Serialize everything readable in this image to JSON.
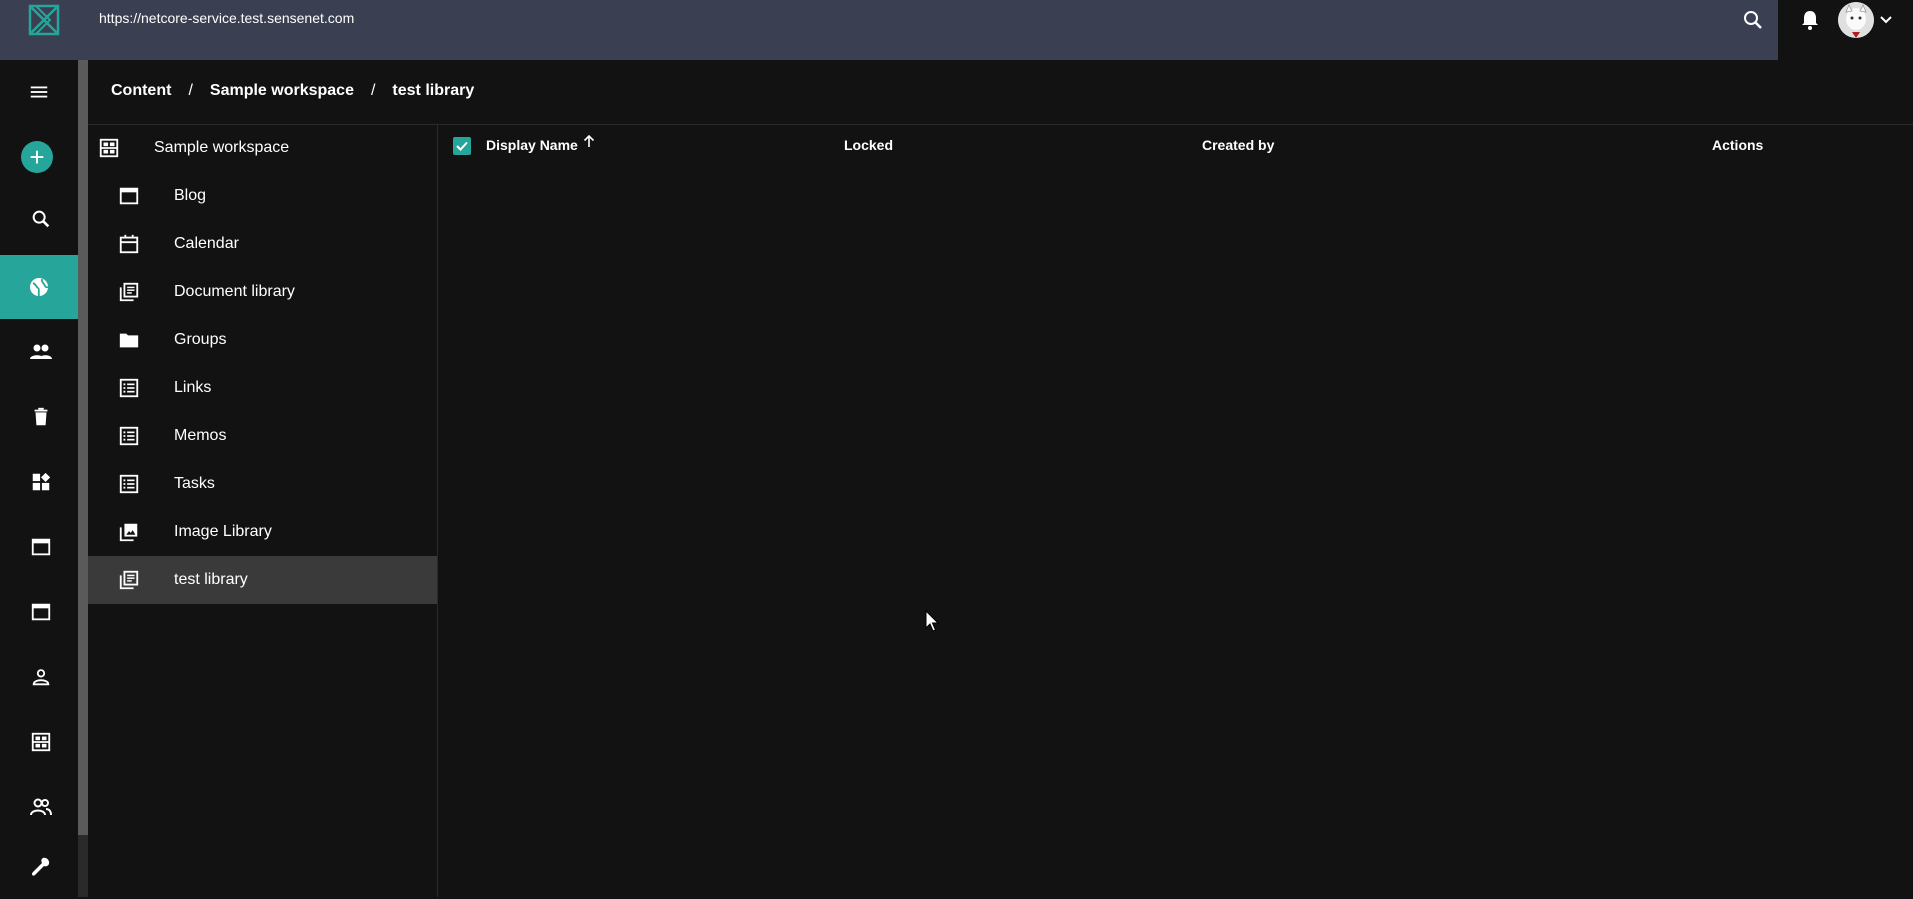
{
  "header": {
    "url": "https://netcore-service.test.sensenet.com"
  },
  "breadcrumb": {
    "items": [
      "Content",
      "Sample workspace",
      "test library"
    ],
    "separator": "/"
  },
  "tree": {
    "root": {
      "label": "Sample workspace",
      "icon": "workspace-icon"
    },
    "items": [
      {
        "label": "Blog",
        "icon": "window-icon",
        "selected": false
      },
      {
        "label": "Calendar",
        "icon": "calendar-icon",
        "selected": false
      },
      {
        "label": "Document library",
        "icon": "library-icon",
        "selected": false
      },
      {
        "label": "Groups",
        "icon": "folder-icon",
        "selected": false
      },
      {
        "label": "Links",
        "icon": "list-icon",
        "selected": false
      },
      {
        "label": "Memos",
        "icon": "list-icon",
        "selected": false
      },
      {
        "label": "Tasks",
        "icon": "list-icon",
        "selected": false
      },
      {
        "label": "Image Library",
        "icon": "image-library-icon",
        "selected": false
      },
      {
        "label": "test library",
        "icon": "library-icon",
        "selected": true
      }
    ]
  },
  "grid": {
    "columns": [
      "Display Name",
      "Locked",
      "Created by",
      "Actions"
    ],
    "sort": {
      "column": "Display Name",
      "direction": "ascending"
    },
    "select_all_checked": true
  },
  "leftnav": {
    "items": [
      "menu-icon",
      "add-icon",
      "search-icon",
      "globe-icon",
      "users-icon",
      "trash-icon",
      "widgets-icon",
      "window-icon",
      "window-icon",
      "person-icon",
      "workspace-icon",
      "group-icon",
      "wrench-icon"
    ],
    "active": "globe-icon"
  },
  "colors": {
    "accent": "#26a69a",
    "topbar": "#3a3f52",
    "background": "#121212",
    "selected_row": "#3a3a3a"
  }
}
